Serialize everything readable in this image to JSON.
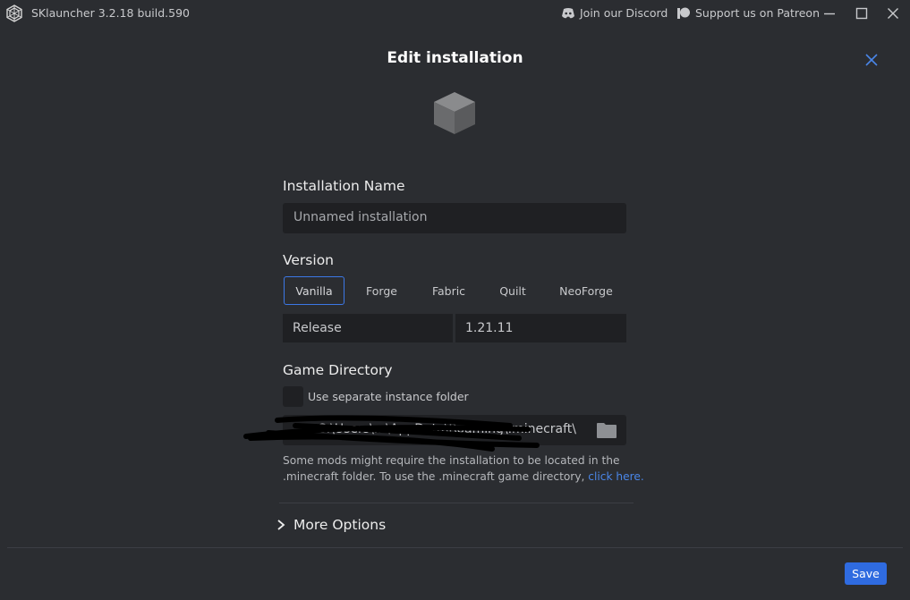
{
  "titlebar": {
    "app_title": "SKlauncher 3.2.18 build.590",
    "discord_label": "Join our Discord",
    "patreon_label": "Support us on Patreon"
  },
  "dialog": {
    "title": "Edit installation"
  },
  "installation_name": {
    "label": "Installation Name",
    "placeholder": "Unnamed installation"
  },
  "version": {
    "label": "Version",
    "tabs": [
      "Vanilla",
      "Forge",
      "Fabric",
      "Quilt",
      "NeoForge"
    ],
    "selected_tab": "Vanilla",
    "type_value": "Release",
    "version_value": "1.21.11"
  },
  "game_directory": {
    "label": "Game Directory",
    "checkbox_label": "Use separate instance folder",
    "checkbox_checked": false,
    "path_value": "C:\\Users\\...\\AppData\\Roaming\\.minecraft\\",
    "hint_line1": "Some mods might require the installation to be located in the",
    "hint_line2": ".minecraft folder. To use the .minecraft game directory,",
    "hint_link": "click here."
  },
  "more_options": {
    "label": "More Options"
  },
  "footer": {
    "save_label": "Save"
  },
  "colors": {
    "background": "#2b2d31",
    "input_background": "#1f2023",
    "accent": "#2f6be0",
    "link": "#4a86e8",
    "active_tab_border": "#3c78e6"
  },
  "icons": [
    "app-logo-icon",
    "discord-icon",
    "patreon-icon",
    "minimize-icon",
    "maximize-icon",
    "window-close-icon",
    "dialog-close-icon",
    "cube-icon",
    "folder-icon",
    "chevron-right-icon"
  ]
}
